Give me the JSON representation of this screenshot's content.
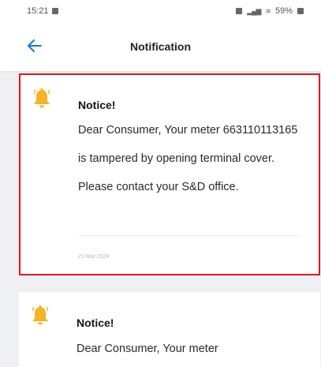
{
  "status_bar": {
    "time": "15:21",
    "battery": "59%"
  },
  "header": {
    "title": "Notification"
  },
  "notifications": [
    {
      "title": "Notice!",
      "message": "Dear Consumer, Your meter 663110113165 is tampered by opening terminal cover. Please contact your S&D office.",
      "date": "21 Mar 2024",
      "icon": "bell-icon",
      "highlighted": true,
      "highlight_color": "#e8141c"
    },
    {
      "title": "Notice!",
      "message": "Dear Consumer, Your meter",
      "icon": "bell-icon",
      "highlighted": false
    }
  ],
  "colors": {
    "accent": "#1a73e8",
    "bell": "#f5b425",
    "highlight": "#e8141c",
    "background": "#eef0f3"
  }
}
